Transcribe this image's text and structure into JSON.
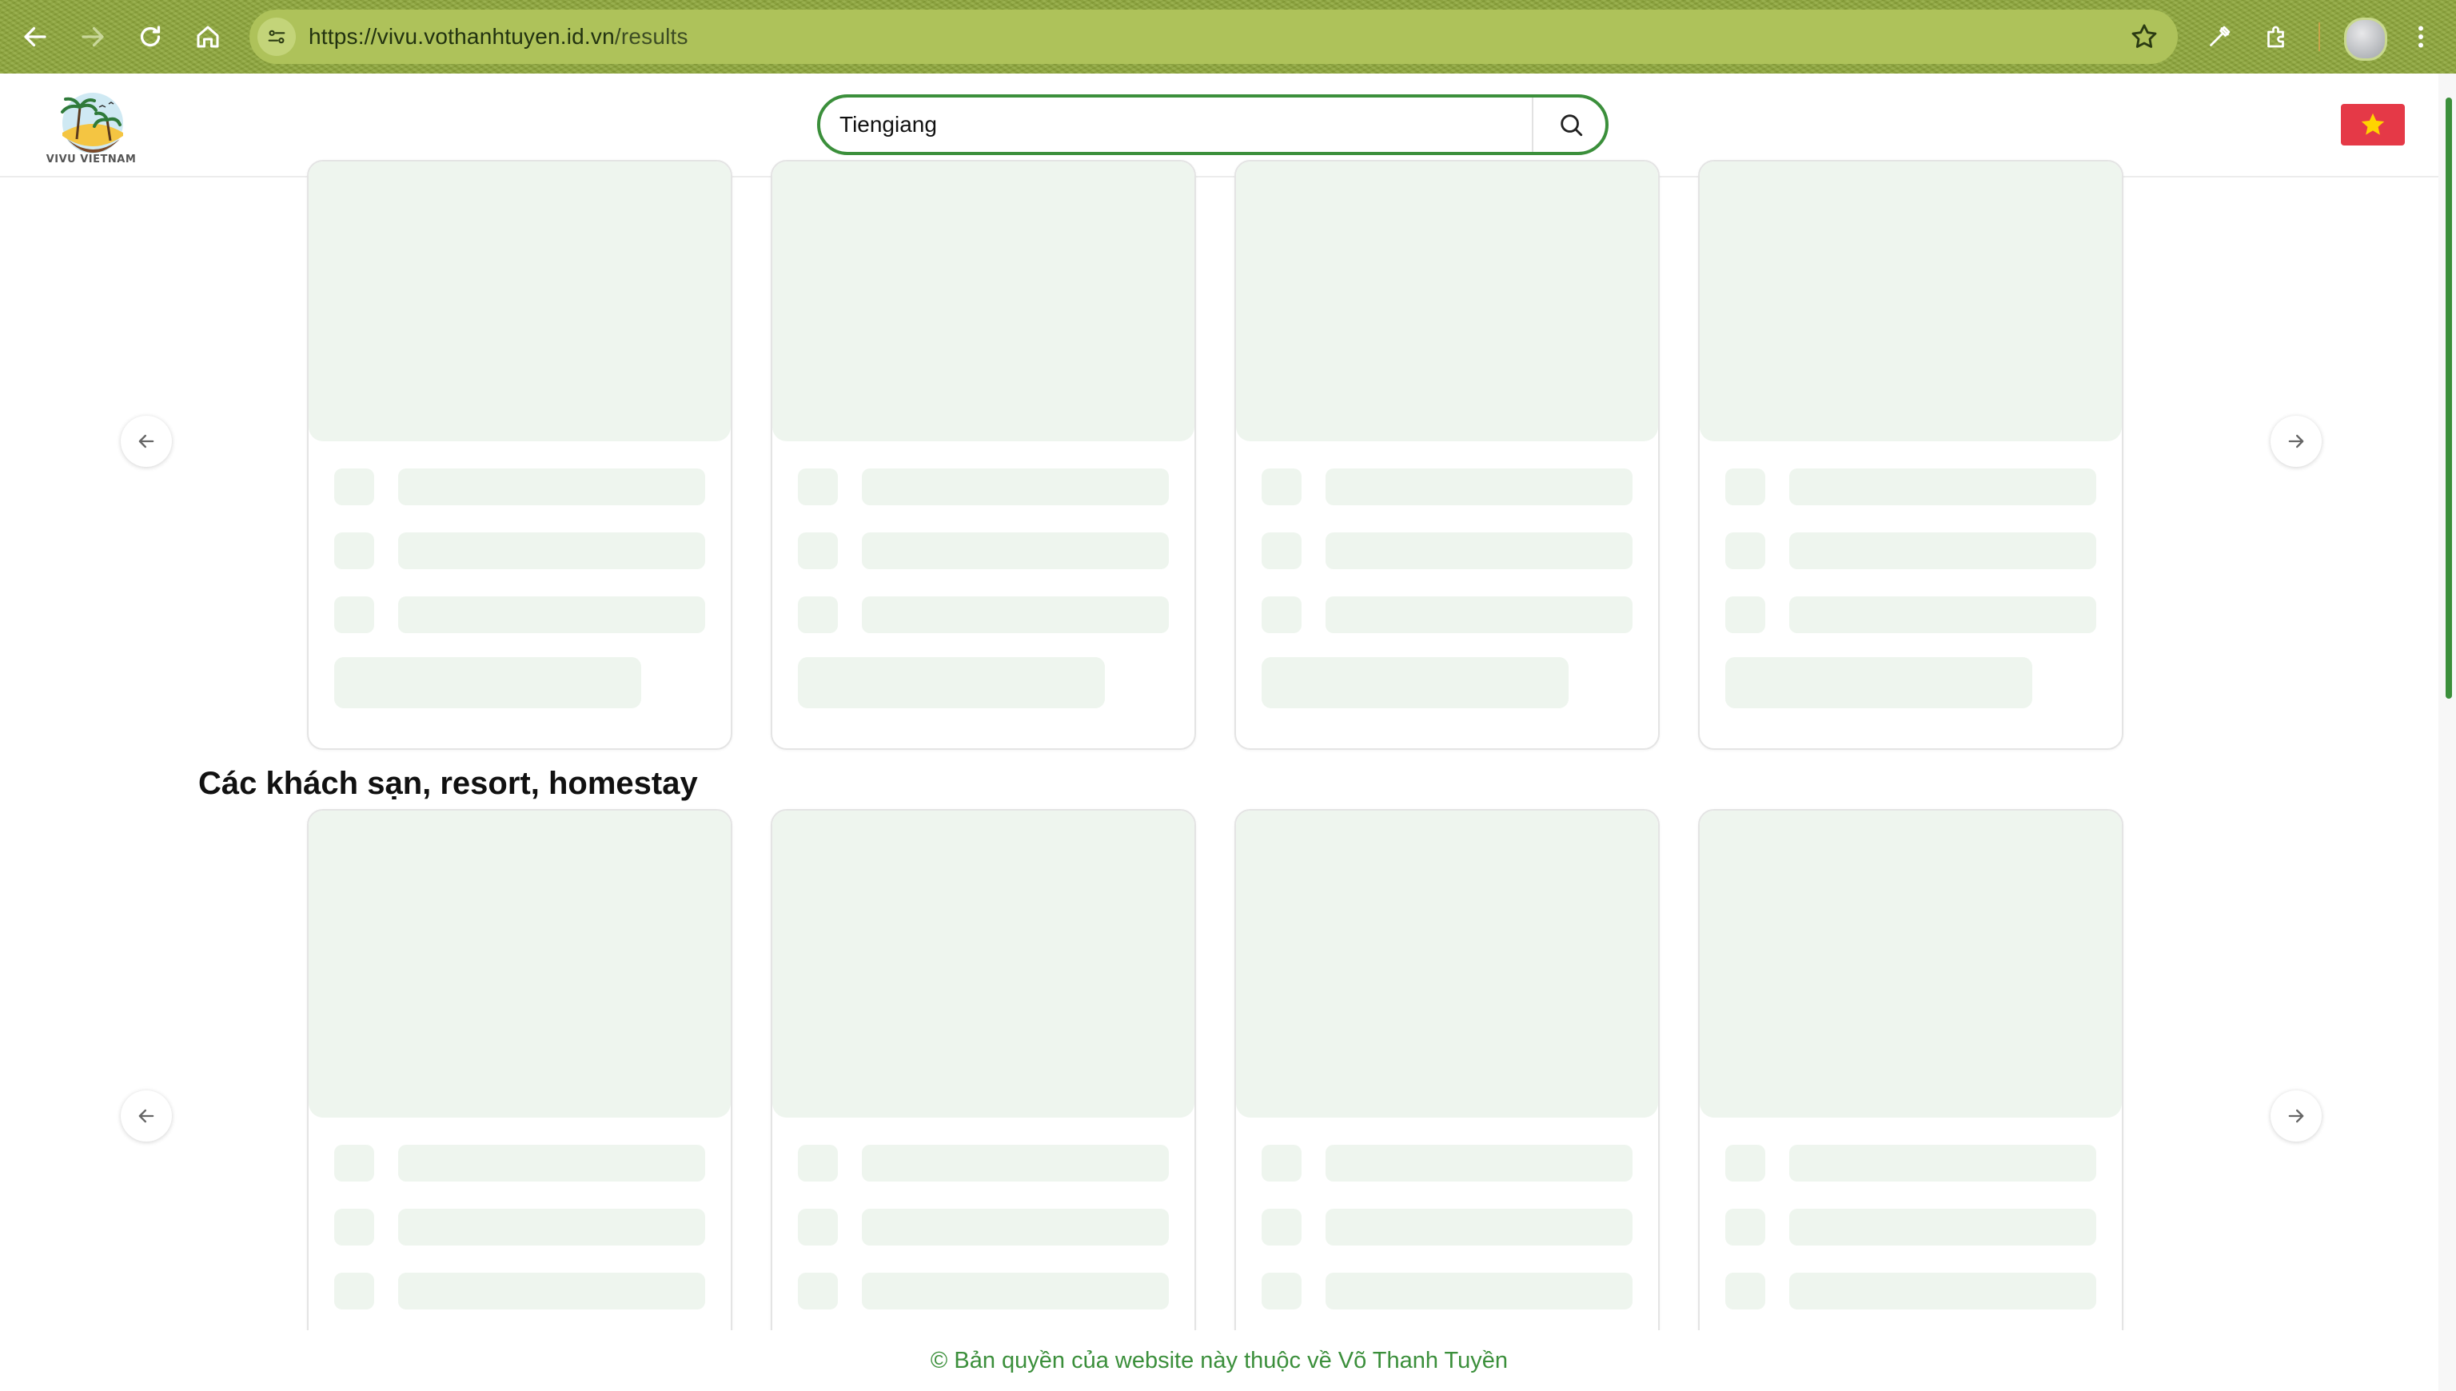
{
  "browser": {
    "url_host": "https://vivu.vothanhtuyen.id.vn",
    "url_path": "/results",
    "buttons": {
      "back": "back-icon",
      "forward": "forward-icon",
      "reload": "reload-icon",
      "home": "home-icon"
    }
  },
  "header": {
    "logo_text": "VIVU VIETNAM",
    "search": {
      "value": "Tiengiang"
    },
    "language": {
      "flag": "vietnam-flag"
    }
  },
  "sections": [
    {
      "title": ""
    },
    {
      "title": "Các khách sạn, resort, homestay"
    }
  ],
  "footer": {
    "copyright": "© Bản quyền của website này thuộc về Võ Thanh Tuyền"
  },
  "colors": {
    "brand_green": "#3b8f3b",
    "skeleton": "#eef5ee",
    "flag_red": "#e53947",
    "flag_star": "#ffd400"
  }
}
